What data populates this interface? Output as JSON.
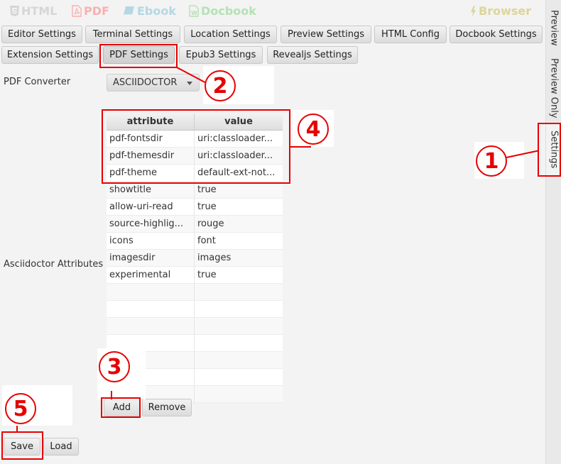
{
  "format_bar": {
    "html": "HTML",
    "pdf": "PDF",
    "ebook": "Ebook",
    "docbook": "Docbook",
    "browser": "Browser"
  },
  "tabs": {
    "row1": [
      "Editor Settings",
      "Terminal Settings",
      "Location Settings",
      "Preview Settings",
      "HTML Config",
      "Docbook Settings"
    ],
    "row2": [
      "Extension Settings",
      "PDF Settings",
      "Epub3 Settings",
      "Revealjs Settings"
    ],
    "selected": "PDF Settings"
  },
  "side_tabs": [
    "Preview",
    "Preview Only",
    "Settings"
  ],
  "pdf_converter": {
    "label": "PDF Converter",
    "value": "ASCIIDOCTOR"
  },
  "attributes": {
    "label": "Asciidoctor Attributes",
    "columns": [
      "attribute",
      "value"
    ],
    "rows": [
      [
        "pdf-fontsdir",
        "uri:classloader..."
      ],
      [
        "pdf-themesdir",
        "uri:classloader..."
      ],
      [
        "pdf-theme",
        "default-ext-not..."
      ],
      [
        "showtitle",
        "true"
      ],
      [
        "allow-uri-read",
        "true"
      ],
      [
        "source-highlig...",
        "rouge"
      ],
      [
        "icons",
        "font"
      ],
      [
        "imagesdir",
        "images"
      ],
      [
        "experimental",
        "true"
      ],
      [
        "",
        ""
      ],
      [
        "",
        ""
      ],
      [
        "",
        ""
      ],
      [
        "",
        ""
      ],
      [
        "",
        ""
      ],
      [
        "",
        ""
      ],
      [
        "",
        ""
      ]
    ],
    "add_label": "Add",
    "remove_label": "Remove"
  },
  "footer": {
    "save_label": "Save",
    "load_label": "Load"
  },
  "annotations": [
    "1",
    "2",
    "3",
    "4",
    "5"
  ],
  "colors": {
    "annotation": "#e60000",
    "html_fmt": "#d6d6d6",
    "pdf_fmt": "#f7b1b1",
    "ebook_fmt": "#b5d7e3",
    "docbook_fmt": "#b4e2b4",
    "browser_fmt": "#ddd59a"
  }
}
